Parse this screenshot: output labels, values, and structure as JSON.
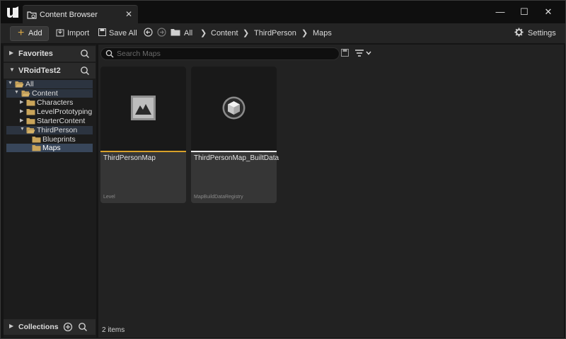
{
  "window": {
    "tab_title": "Content Browser",
    "controls": {
      "minimize": "—",
      "maximize": "☐",
      "close": "✕"
    }
  },
  "toolbar": {
    "add_label": "Add",
    "import_label": "Import",
    "save_all_label": "Save All",
    "settings_label": "Settings",
    "breadcrumbs": [
      "All",
      "Content",
      "ThirdPerson",
      "Maps"
    ]
  },
  "sidebar": {
    "favorites_label": "Favorites",
    "project_label": "VRoidTest2",
    "collections_label": "Collections",
    "tree": [
      {
        "label": "All",
        "expanded": true
      },
      {
        "label": "Content",
        "expanded": true
      },
      {
        "label": "Characters",
        "expanded": false
      },
      {
        "label": "LevelPrototyping",
        "expanded": false
      },
      {
        "label": "StarterContent",
        "expanded": false
      },
      {
        "label": "ThirdPerson",
        "expanded": true
      },
      {
        "label": "Blueprints",
        "expanded": false
      },
      {
        "label": "Maps",
        "expanded": false,
        "selected": true
      }
    ]
  },
  "search": {
    "placeholder": "Search Maps",
    "value": ""
  },
  "assets": [
    {
      "name": "ThirdPersonMap",
      "type": "Level",
      "accent": "#d8a12a",
      "icon": "level-icon"
    },
    {
      "name": "ThirdPersonMap_BuiltData",
      "type": "MapBuildDataRegistry",
      "accent": "#e8e8e8",
      "icon": "cube-icon"
    }
  ],
  "status": {
    "item_count": "2 items"
  },
  "colors": {
    "folder": "#c9a45a",
    "selection": "#38465a",
    "level_accent": "#d8a12a"
  }
}
